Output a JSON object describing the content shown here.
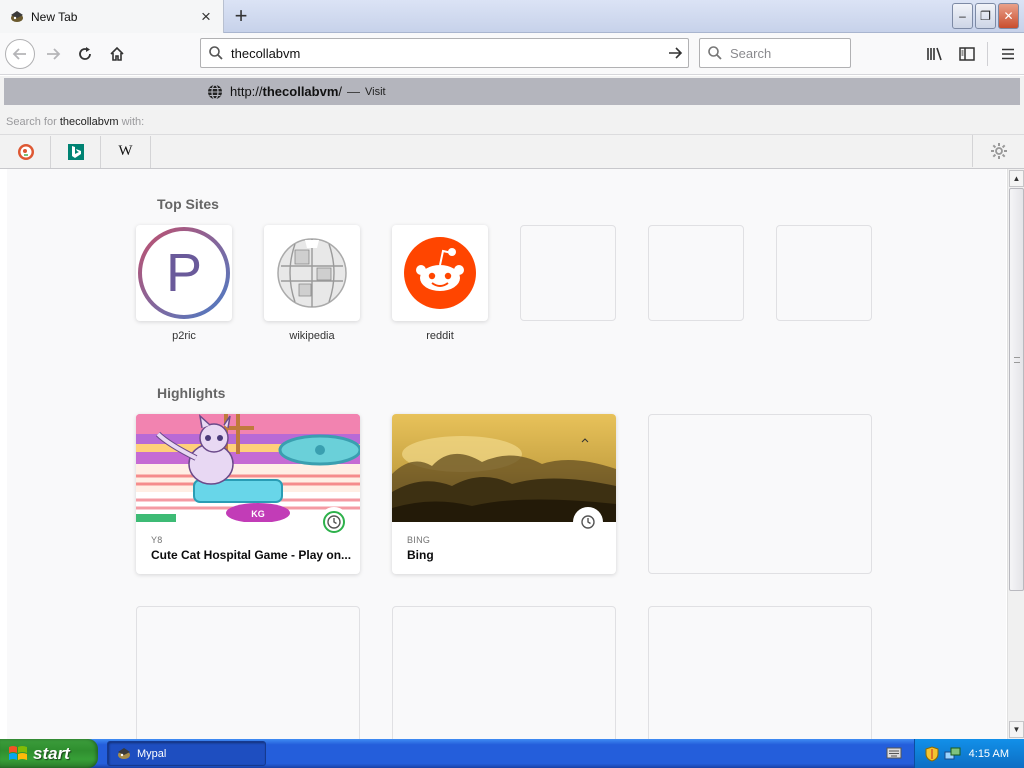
{
  "tab": {
    "title": "New Tab",
    "close": "×",
    "new": "+"
  },
  "window": {
    "minimize": "–",
    "maximize": "❐",
    "close": "✕"
  },
  "urlbar": {
    "value": "thecollabvm"
  },
  "searchbar": {
    "placeholder": "Search"
  },
  "dropdown": {
    "url_prefix": "http://",
    "url_bold": "thecollabvm",
    "url_suffix": "/",
    "dash": "—",
    "visit": "Visit",
    "search_for_prefix": "Search for",
    "search_for_query": "thecollabvm",
    "search_for_suffix": "with:",
    "engines": [
      "duckduckgo-icon",
      "bing-icon",
      "wikipedia-icon"
    ],
    "wikipedia_letter": "W"
  },
  "top_sites": {
    "title": "Top Sites",
    "items": [
      {
        "label": "p2ric",
        "letter": "P"
      },
      {
        "label": "wikipedia"
      },
      {
        "label": "reddit"
      },
      {
        "label": ""
      },
      {
        "label": ""
      },
      {
        "label": ""
      }
    ]
  },
  "highlights": {
    "title": "Highlights",
    "cards": [
      {
        "source": "Y8",
        "title": "Cute Cat Hospital Game - Play on...",
        "button_text": "KG"
      },
      {
        "source": "BING",
        "title": "Bing"
      }
    ]
  },
  "taskbar": {
    "start": "start",
    "task": "Mypal",
    "time": "4:15 AM"
  },
  "colors": {
    "reddit": "#ff4500",
    "bing": "#008373",
    "accent": "#0a84ff",
    "taskbar": "#245edb",
    "start": "#3c9d3c"
  }
}
